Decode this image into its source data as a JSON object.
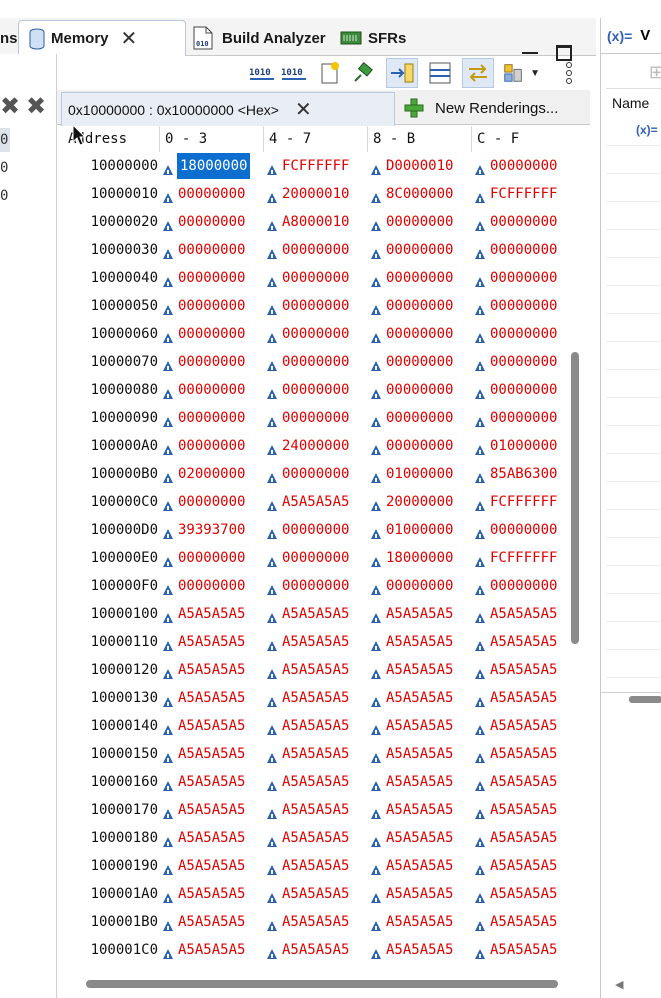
{
  "tabs": {
    "clipped_tab": "ns",
    "memory": "Memory",
    "build_analyzer": "Build Analyzer",
    "sfrs": "SFRs"
  },
  "left_panel": {
    "row_values": [
      "0",
      "0",
      "0"
    ]
  },
  "toolbar": {
    "icons": [
      "toggle-1010-icon",
      "toggle-1010-alt-icon",
      "new-icon",
      "pin-icon",
      "link-icon",
      "split-icon",
      "sync-icon",
      "layout-icon",
      "view-menu-icon"
    ]
  },
  "rendering": {
    "tab_label": "0x10000000 : 0x10000000 <Hex>",
    "new_renderings_label": "New Renderings..."
  },
  "memory": {
    "headers": [
      "Address",
      "0 - 3",
      "4 - 7",
      "8 - B",
      "C - F"
    ],
    "selected": {
      "row": 0,
      "col": 0
    },
    "rows": [
      {
        "addr": "10000000",
        "cells": [
          "18000000",
          "FCFFFFFF",
          "D0000010",
          "00000000"
        ]
      },
      {
        "addr": "10000010",
        "cells": [
          "00000000",
          "20000010",
          "8C000000",
          "FCFFFFFF"
        ]
      },
      {
        "addr": "10000020",
        "cells": [
          "00000000",
          "A8000010",
          "00000000",
          "00000000"
        ]
      },
      {
        "addr": "10000030",
        "cells": [
          "00000000",
          "00000000",
          "00000000",
          "00000000"
        ]
      },
      {
        "addr": "10000040",
        "cells": [
          "00000000",
          "00000000",
          "00000000",
          "00000000"
        ]
      },
      {
        "addr": "10000050",
        "cells": [
          "00000000",
          "00000000",
          "00000000",
          "00000000"
        ]
      },
      {
        "addr": "10000060",
        "cells": [
          "00000000",
          "00000000",
          "00000000",
          "00000000"
        ]
      },
      {
        "addr": "10000070",
        "cells": [
          "00000000",
          "00000000",
          "00000000",
          "00000000"
        ]
      },
      {
        "addr": "10000080",
        "cells": [
          "00000000",
          "00000000",
          "00000000",
          "00000000"
        ]
      },
      {
        "addr": "10000090",
        "cells": [
          "00000000",
          "00000000",
          "00000000",
          "00000000"
        ]
      },
      {
        "addr": "100000A0",
        "cells": [
          "00000000",
          "24000000",
          "00000000",
          "01000000"
        ]
      },
      {
        "addr": "100000B0",
        "cells": [
          "02000000",
          "00000000",
          "01000000",
          "85AB6300"
        ]
      },
      {
        "addr": "100000C0",
        "cells": [
          "00000000",
          "A5A5A5A5",
          "20000000",
          "FCFFFFFF"
        ]
      },
      {
        "addr": "100000D0",
        "cells": [
          "39393700",
          "00000000",
          "01000000",
          "00000000"
        ]
      },
      {
        "addr": "100000E0",
        "cells": [
          "00000000",
          "00000000",
          "18000000",
          "FCFFFFFF"
        ]
      },
      {
        "addr": "100000F0",
        "cells": [
          "00000000",
          "00000000",
          "00000000",
          "00000000"
        ]
      },
      {
        "addr": "10000100",
        "cells": [
          "A5A5A5A5",
          "A5A5A5A5",
          "A5A5A5A5",
          "A5A5A5A5"
        ]
      },
      {
        "addr": "10000110",
        "cells": [
          "A5A5A5A5",
          "A5A5A5A5",
          "A5A5A5A5",
          "A5A5A5A5"
        ]
      },
      {
        "addr": "10000120",
        "cells": [
          "A5A5A5A5",
          "A5A5A5A5",
          "A5A5A5A5",
          "A5A5A5A5"
        ]
      },
      {
        "addr": "10000130",
        "cells": [
          "A5A5A5A5",
          "A5A5A5A5",
          "A5A5A5A5",
          "A5A5A5A5"
        ]
      },
      {
        "addr": "10000140",
        "cells": [
          "A5A5A5A5",
          "A5A5A5A5",
          "A5A5A5A5",
          "A5A5A5A5"
        ]
      },
      {
        "addr": "10000150",
        "cells": [
          "A5A5A5A5",
          "A5A5A5A5",
          "A5A5A5A5",
          "A5A5A5A5"
        ]
      },
      {
        "addr": "10000160",
        "cells": [
          "A5A5A5A5",
          "A5A5A5A5",
          "A5A5A5A5",
          "A5A5A5A5"
        ]
      },
      {
        "addr": "10000170",
        "cells": [
          "A5A5A5A5",
          "A5A5A5A5",
          "A5A5A5A5",
          "A5A5A5A5"
        ]
      },
      {
        "addr": "10000180",
        "cells": [
          "A5A5A5A5",
          "A5A5A5A5",
          "A5A5A5A5",
          "A5A5A5A5"
        ]
      },
      {
        "addr": "10000190",
        "cells": [
          "A5A5A5A5",
          "A5A5A5A5",
          "A5A5A5A5",
          "A5A5A5A5"
        ]
      },
      {
        "addr": "100001A0",
        "cells": [
          "A5A5A5A5",
          "A5A5A5A5",
          "A5A5A5A5",
          "A5A5A5A5"
        ]
      },
      {
        "addr": "100001B0",
        "cells": [
          "A5A5A5A5",
          "A5A5A5A5",
          "A5A5A5A5",
          "A5A5A5A5"
        ]
      },
      {
        "addr": "100001C0",
        "cells": [
          "A5A5A5A5",
          "A5A5A5A5",
          "A5A5A5A5",
          "A5A5A5A5"
        ]
      }
    ]
  },
  "variables_panel": {
    "tab_icon": "(x)=",
    "tab_label": "V",
    "column_name": "Name",
    "row_icon": "(x)="
  },
  "colors": {
    "changed_value": "#e00000",
    "selection": "#0c6fd0",
    "marker": "#2b63b0"
  }
}
